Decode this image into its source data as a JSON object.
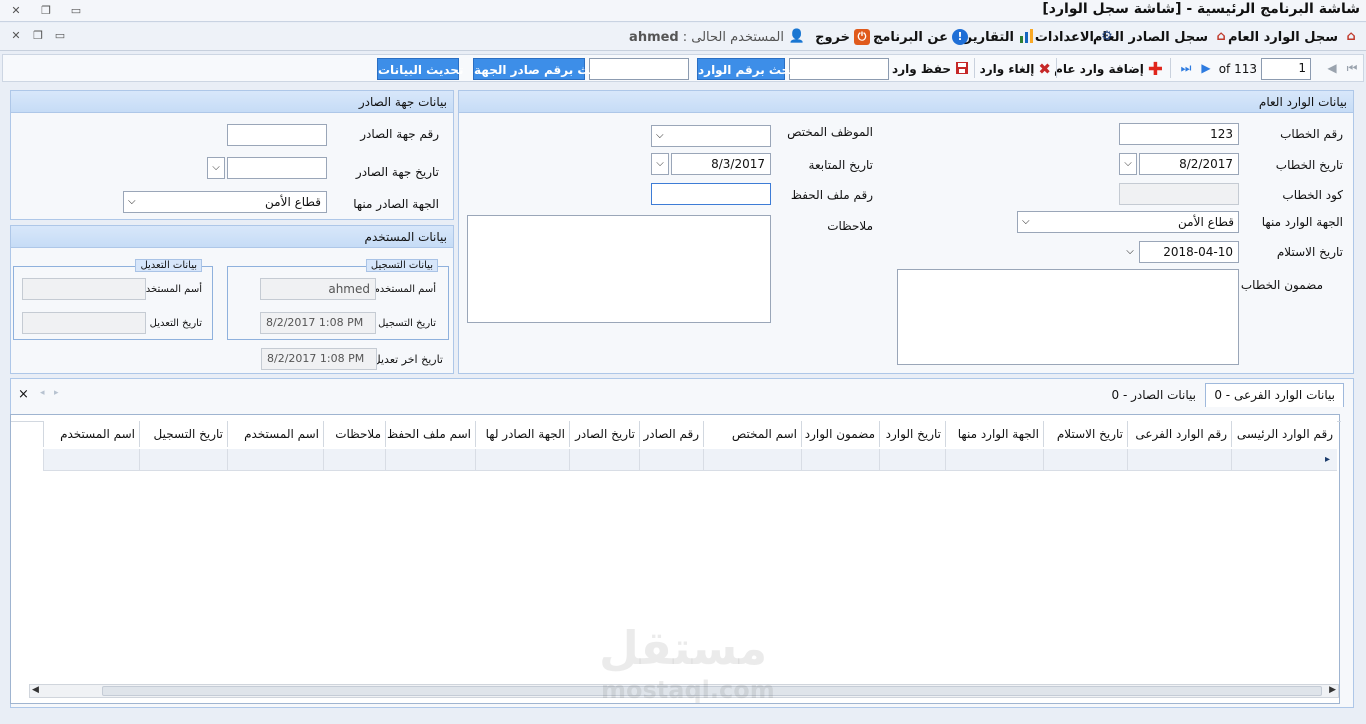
{
  "window": {
    "title": "شاشة البرنامج الرئيسية - [شاشة سجل الوارد]"
  },
  "menu": {
    "items": [
      {
        "label": "سجل الوارد العام",
        "icon": "home-icon"
      },
      {
        "label": "سجل الصادر العام",
        "icon": "home-icon"
      },
      {
        "label": "الاعدادات",
        "icon": "gear-icon"
      },
      {
        "label": "التقارير",
        "icon": "bar-chart-icon"
      },
      {
        "label": "عن البرنامج",
        "icon": "info-icon"
      },
      {
        "label": "خروج",
        "icon": "power-icon"
      }
    ],
    "current_user_label": "المستخدم الحالى :",
    "current_user": "ahmed"
  },
  "toolbar": {
    "record_position": "1",
    "record_total": "of 113",
    "add_label": "إضافة وارد عام",
    "cancel_label": "إلغاء وارد",
    "save_label": "حفظ وارد",
    "search_incoming_label": "بحث برقم الوارد",
    "search_incoming_value": "",
    "search_outgoing_label": "بحث برقم صادر الجهة",
    "search_outgoing_value": "",
    "refresh_label": "تحديث البيانات"
  },
  "general_incoming": {
    "header": "بيانات الوارد العام",
    "letter_no_label": "رقم الخطاب",
    "letter_no": "123",
    "letter_date_label": "تاريخ الخطاب",
    "letter_date": "8/2/2017",
    "letter_code_label": "كود الخطاب",
    "letter_code": "",
    "source_label": "الجهة الوارد منها",
    "source": "قطاع الأمن",
    "receipt_date_label": "تاريخ الاستلام",
    "receipt_date": "2018-04-10",
    "content_label": "مضمون الخطاب",
    "content": "",
    "employee_label": "الموظف المختص",
    "employee": "",
    "followup_date_label": "تاريخ المتابعة",
    "followup_date": "8/3/2017",
    "file_no_label": "رقم ملف الحفظ",
    "file_no": "",
    "notes_label": "ملاحظات",
    "notes": ""
  },
  "issuer": {
    "header": "بيانات جهة الصادر",
    "issuer_no_label": "رقم جهة الصادر",
    "issuer_no": "",
    "issuer_date_label": "تاريخ جهة الصادر",
    "issuer_date": "",
    "issued_from_label": "الجهة الصادر منها",
    "issued_from": "قطاع الأمن"
  },
  "user_data": {
    "header": "بيانات المستخدم",
    "registration_group": "بيانات التسجيل",
    "reg_user_label": "أسم المستخدم",
    "reg_user": "ahmed",
    "reg_date_label": "تاريخ التسجيل",
    "reg_date": "8/2/2017 1:08 PM",
    "edit_group": "بيانات التعديل",
    "edit_user_label": "أسم المستخدم",
    "edit_user": "",
    "edit_date_label": "تاريخ التعديل",
    "edit_date": "",
    "last_edit_label": "تاريخ اخر تعديل",
    "last_edit": "8/2/2017 1:08 PM"
  },
  "tabs": {
    "sub_incoming": "بيانات الوارد الفرعى - 0",
    "outgoing": "بيانات الصادر - 0",
    "close": "×"
  },
  "grid": {
    "columns": [
      "رقم الوارد الرئيسى",
      "رقم الوارد الفرعى",
      "تاريخ الاستلام",
      "الجهة الوارد منها",
      "تاريخ الوارد",
      "مضمون الوارد",
      "اسم المختص",
      "رقم الصادر",
      "تاريخ الصادر",
      "الجهة الصادر لها",
      "اسم ملف الحفظ",
      "ملاحظات",
      "اسم المستخدم",
      "تاريخ التسجيل",
      "اسم المستخدم"
    ]
  },
  "watermark": {
    "text": "مستقل",
    "sub": "mostaql.com"
  }
}
